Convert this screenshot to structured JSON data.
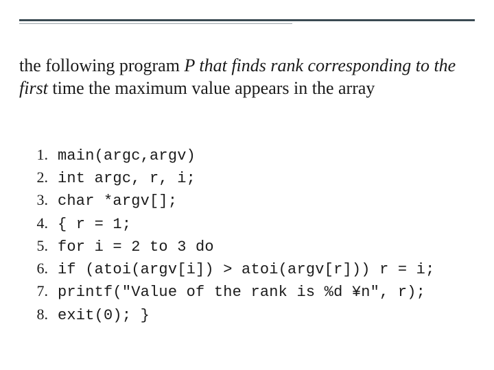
{
  "heading": {
    "seg1_plain": "the following program ",
    "seg2_italic": "P that finds rank corresponding to the first ",
    "seg3_plain": "time the maximum  value appears in the array"
  },
  "code": {
    "lines": [
      {
        "n": "1.",
        "text": "main(argc,argv)"
      },
      {
        "n": "2.",
        "text": "int argc, r, i;"
      },
      {
        "n": "3.",
        "text": "char *argv[];"
      },
      {
        "n": "4.",
        "text": "{ r = 1;"
      },
      {
        "n": "5.",
        "text": "for i = 2 to 3 do"
      },
      {
        "n": "6.",
        "text": "if (atoi(argv[i]) > atoi(argv[r])) r = i;"
      },
      {
        "n": "7.",
        "text": "printf(\"Value of the rank is %d ¥n\", r);"
      },
      {
        "n": "8.",
        "text": "exit(0); }"
      }
    ]
  }
}
